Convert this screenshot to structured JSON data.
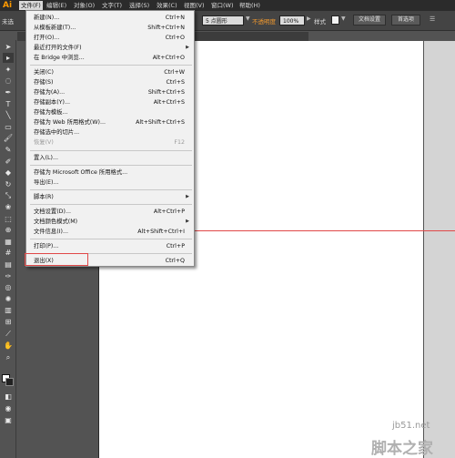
{
  "app": {
    "logo": "Ai"
  },
  "menubar": {
    "items": [
      {
        "label": "文件(F)",
        "active": true
      },
      {
        "label": "编辑(E)"
      },
      {
        "label": "对象(O)"
      },
      {
        "label": "文字(T)"
      },
      {
        "label": "选择(S)"
      },
      {
        "label": "效果(C)"
      },
      {
        "label": "视图(V)"
      },
      {
        "label": "窗口(W)"
      },
      {
        "label": "帮助(H)"
      }
    ]
  },
  "controlbar": {
    "doc_label": "未选",
    "stroke_profile": "5 点圆形",
    "opacity_label": "不透明度",
    "opacity_value": "100%",
    "style_label": "样式",
    "doc_setup_button": "文档设置",
    "preferences_button": "首选项",
    "accent_color": "#f39a2e"
  },
  "file_menu": {
    "items": [
      {
        "label": "新建(N)...",
        "shortcut": "Ctrl+N"
      },
      {
        "label": "从模板新建(T)...",
        "shortcut": "Shift+Ctrl+N"
      },
      {
        "label": "打开(O)...",
        "shortcut": "Ctrl+O"
      },
      {
        "label": "最近打开的文件(F)",
        "submenu": true
      },
      {
        "label": "在 Bridge 中浏览...",
        "shortcut": "Alt+Ctrl+O"
      },
      {
        "label": "关闭(C)",
        "shortcut": "Ctrl+W"
      },
      {
        "label": "存储(S)",
        "shortcut": "Ctrl+S"
      },
      {
        "label": "存储为(A)...",
        "shortcut": "Shift+Ctrl+S"
      },
      {
        "label": "存储副本(Y)...",
        "shortcut": "Alt+Ctrl+S"
      },
      {
        "label": "存储为模板..."
      },
      {
        "label": "存储为 Web 所用格式(W)...",
        "shortcut": "Alt+Shift+Ctrl+S"
      },
      {
        "label": "存储选中的切片..."
      },
      {
        "label": "恢复(V)",
        "shortcut": "F12",
        "disabled": true
      },
      {
        "label": "置入(L)..."
      },
      {
        "label": "存储为 Microsoft Office 所用格式..."
      },
      {
        "label": "导出(E)..."
      },
      {
        "label": "脚本(R)",
        "submenu": true
      },
      {
        "label": "文档设置(D)...",
        "shortcut": "Alt+Ctrl+P"
      },
      {
        "label": "文档颜色模式(M)",
        "submenu": true
      },
      {
        "label": "文件信息(I)...",
        "shortcut": "Alt+Shift+Ctrl+I"
      },
      {
        "label": "打印(P)...",
        "shortcut": "Ctrl+P"
      },
      {
        "label": "退出(X)",
        "shortcut": "Ctrl+Q"
      }
    ]
  },
  "annotation": {
    "highlight_color": "#e04848"
  },
  "tools": {
    "items": [
      "selection-tool",
      "direct-selection-tool",
      "magic-wand-tool",
      "lasso-tool",
      "pen-tool",
      "type-tool",
      "line-segment-tool",
      "rectangle-tool",
      "paintbrush-tool",
      "pencil-tool",
      "blob-brush-tool",
      "eraser-tool",
      "rotate-tool",
      "scale-tool",
      "warp-tool",
      "free-transform-tool",
      "shape-builder-tool",
      "perspective-grid-tool",
      "mesh-tool",
      "gradient-tool",
      "eyedropper-tool",
      "blend-tool",
      "symbol-sprayer-tool",
      "column-graph-tool",
      "artboard-tool",
      "slice-tool",
      "hand-tool",
      "zoom-tool"
    ]
  },
  "watermark": {
    "url": "jb51.net",
    "name": "脚本之家"
  }
}
